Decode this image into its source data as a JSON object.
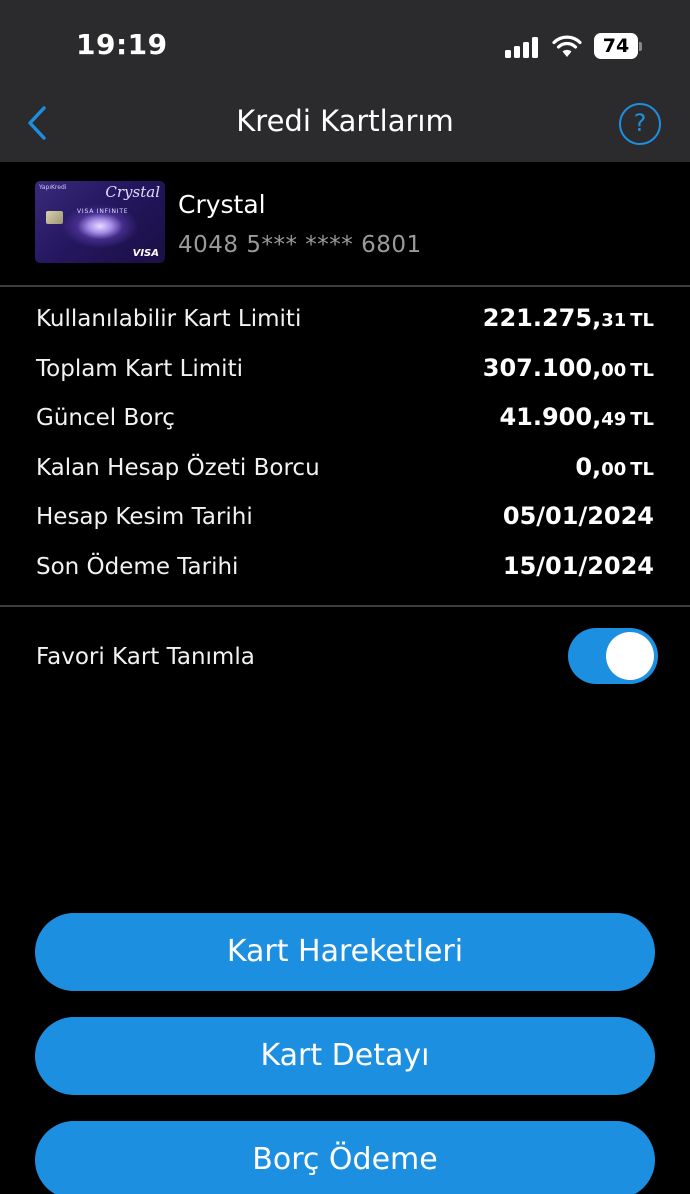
{
  "status_bar": {
    "time": "19:19",
    "battery": "74"
  },
  "nav": {
    "title": "Kredi Kartlarım",
    "help_glyph": "?"
  },
  "card": {
    "name": "Crystal",
    "number": "4048 5*** **** 6801",
    "image_brand": "Crystal",
    "image_tier": "VISA INFINITE",
    "image_network": "VISA",
    "image_bank": "YapıKredi"
  },
  "details": [
    {
      "label": "Kullanılabilir Kart Limiti",
      "value_main": "221.275,",
      "value_dec": "31",
      "value_cur": "TL"
    },
    {
      "label": "Toplam Kart Limiti",
      "value_main": "307.100,",
      "value_dec": "00",
      "value_cur": "TL"
    },
    {
      "label": "Güncel Borç",
      "value_main": "41.900,",
      "value_dec": "49",
      "value_cur": "TL"
    },
    {
      "label": "Kalan Hesap Özeti Borcu",
      "value_main": "0,",
      "value_dec": "00",
      "value_cur": "TL"
    },
    {
      "label": "Hesap Kesim Tarihi",
      "value_main": "05/01/2024",
      "value_dec": "",
      "value_cur": ""
    },
    {
      "label": "Son Ödeme Tarihi",
      "value_main": "15/01/2024",
      "value_dec": "",
      "value_cur": ""
    }
  ],
  "favorite": {
    "label": "Favori Kart Tanımla",
    "enabled": true
  },
  "actions": {
    "transactions": "Kart Hareketleri",
    "card_detail": "Kart Detayı",
    "payment": "Borç Ödeme"
  },
  "colors": {
    "accent": "#1d8fe0",
    "header_bg": "#2b2b2d",
    "background": "#000000"
  }
}
